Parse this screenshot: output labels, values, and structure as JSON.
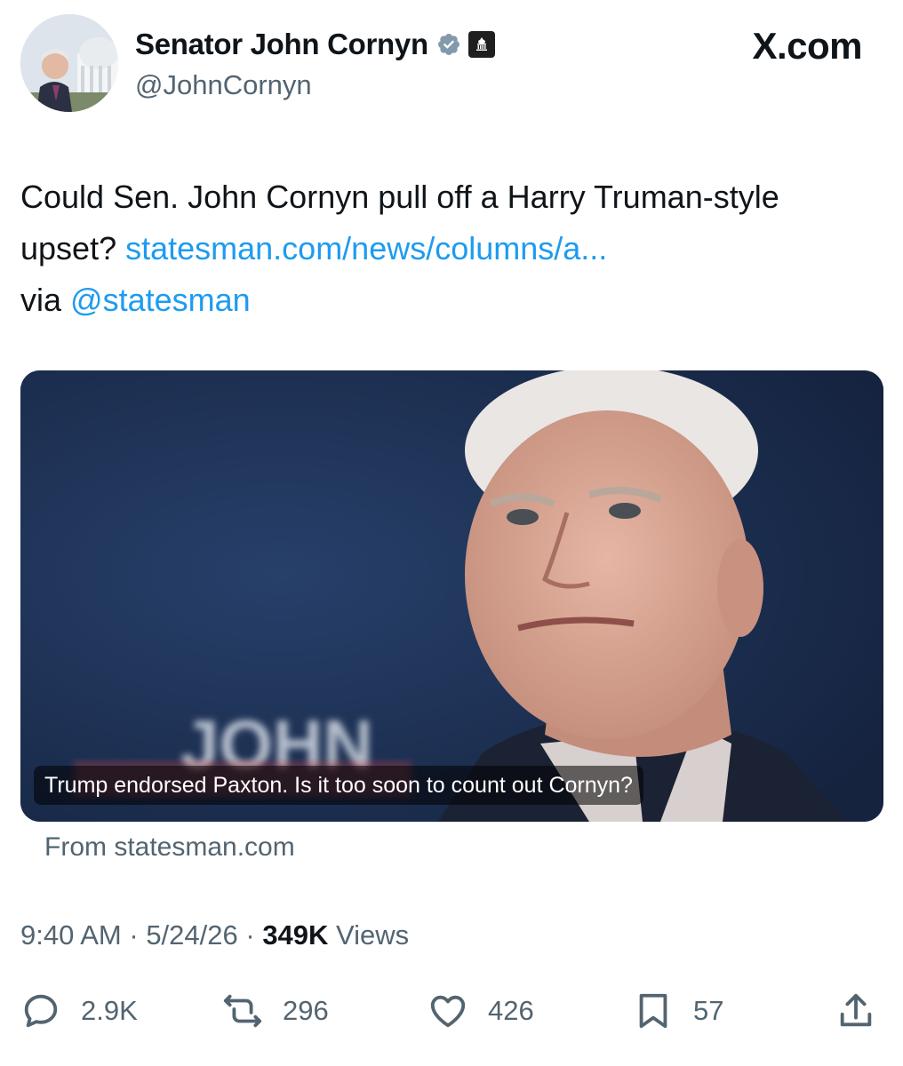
{
  "author": {
    "name": "Senator John Cornyn",
    "handle": "@JohnCornyn",
    "verified_icon": "verified-badge-icon",
    "affiliation_icon": "government-building-icon"
  },
  "brand": "X.com",
  "tweet": {
    "text": "Could Sen. John Cornyn pull off a Harry Truman-style upset? ",
    "link": "statesman.com/news/columns/a...",
    "via_prefix": "via ",
    "via_mention": "@statesman"
  },
  "card": {
    "caption": "Trump endorsed Paxton. Is it too soon to count out Cornyn?",
    "source": "From statesman.com",
    "backdrop_text": "JOHN"
  },
  "meta": {
    "time": "9:40 AM",
    "separator": " · ",
    "date": "5/24/26",
    "views_count": "349K",
    "views_label": " Views"
  },
  "actions": {
    "replies": "2.9K",
    "reposts": "296",
    "likes": "426",
    "bookmarks": "57"
  },
  "colors": {
    "link": "#1d9bf0",
    "secondary_text": "#536471",
    "primary_text": "#0f1419",
    "verified_badge": "#829aab"
  }
}
